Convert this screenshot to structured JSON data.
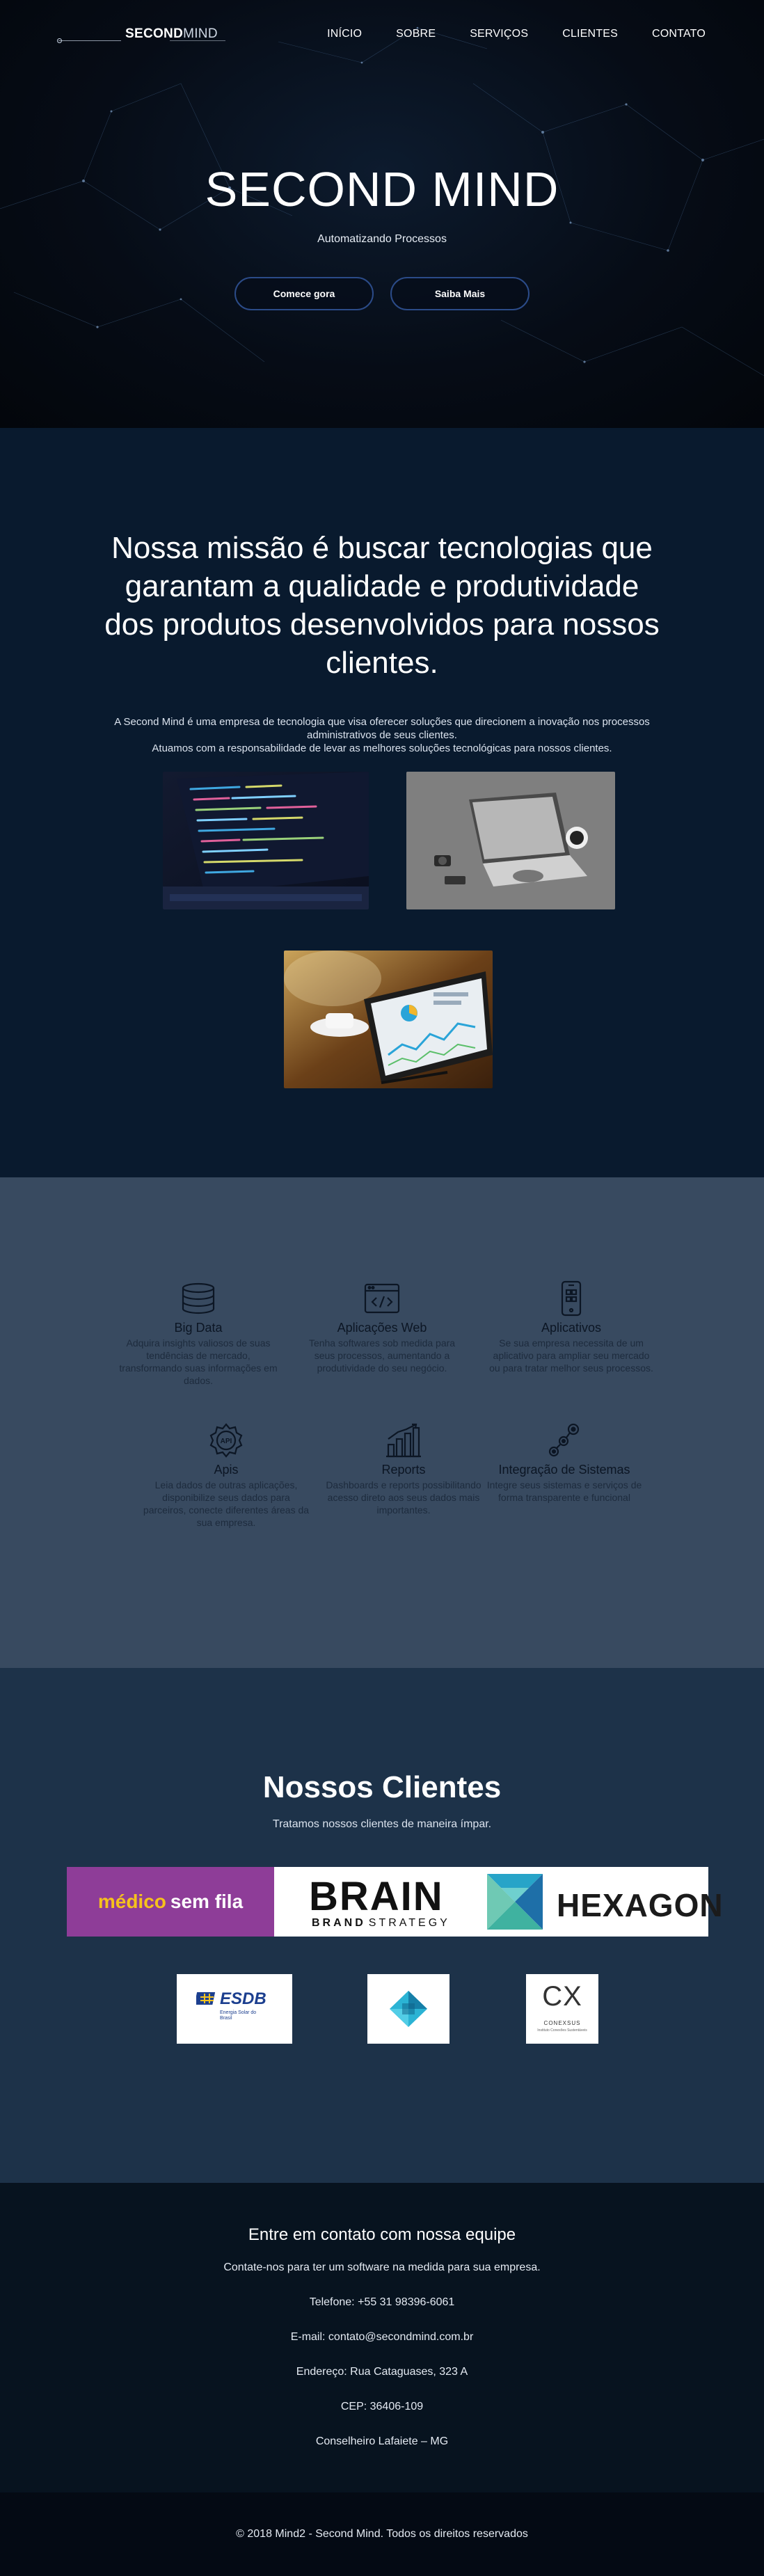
{
  "nav": {
    "logo": {
      "strong": "SECOND",
      "light": "MIND"
    },
    "items": [
      "INÍCIO",
      "SOBRE",
      "SERVIÇOS",
      "CLIENTES",
      "CONTATO"
    ]
  },
  "hero": {
    "title": "SECOND MIND",
    "subtitle": "Automatizando Processos",
    "btn_start": "Comece gora",
    "btn_more": "Saiba Mais"
  },
  "mission": {
    "heading": "Nossa missão é buscar tecnologias que garantam a qualidade e produtividade dos produtos desenvolvidos para nossos clientes.",
    "p1": "A Second Mind é uma empresa de tecnologia que visa oferecer soluções que direcionem a inovação nos processos administrativos de seus clientes.",
    "p2": "Atuamos com a responsabilidade de levar as melhores soluções tecnológicas para nossos clientes."
  },
  "services": [
    {
      "icon": "database-icon",
      "title": "Big Data",
      "text": "Adquira insights valiosos de suas tendências de mercado, transformando suas informações em dados."
    },
    {
      "icon": "code-window-icon",
      "title": "Aplicações Web",
      "text": "Tenha softwares sob medida para seus processos, aumentando a produtividade do seu negócio."
    },
    {
      "icon": "smartphone-icon",
      "title": "Aplicativos",
      "text": "Se sua empresa necessita de um aplicativo para ampliar seu mercado ou para tratar melhor seus processos."
    },
    {
      "icon": "api-gear-icon",
      "title": "Apis",
      "text": "Leia dados de outras aplicações, disponibilize seus dados para parceiros, conecte diferentes áreas da sua empresa."
    },
    {
      "icon": "bar-chart-icon",
      "title": "Reports",
      "text": "Dashboards e reports possibilitando acesso direto aos seus dados mais importantes."
    },
    {
      "icon": "integration-icon",
      "title": "Integração de Sistemas",
      "text": "Integre seus sistemas e serviços de forma transparente e funcional"
    }
  ],
  "clients": {
    "title": "Nossos Clientes",
    "subtitle": "Tratamos nossos clientes de maneira ímpar.",
    "logos": {
      "medico": {
        "a": "médico",
        "b": "sem fila"
      },
      "brain": {
        "main": "BRAIN",
        "sub_a": "BRAND",
        "sub_b": "STRATEGY"
      },
      "hexagon": "HEXAGON",
      "esdb": {
        "main": "ESDB",
        "sub": "Energia Solar do Brasil"
      },
      "conexsus": {
        "mark": "CX",
        "name": "CONEXSUS",
        "sub": "Instituto Conexões Sustentáveis"
      }
    }
  },
  "contact": {
    "title": "Entre em contato com nossa equipe",
    "intro": "Contate-nos para ter um software na medida para sua empresa.",
    "phone": "Telefone: +55 31 98396-6061",
    "email": "E-mail: contato@secondmind.com.br",
    "address": "Endereço: Rua Cataguases, 323 A",
    "cep": "CEP: 36406-109",
    "city": "Conselheiro Lafaiete – MG"
  },
  "footer": {
    "copyright": "© 2018 Mind2 - Second Mind. Todos os direitos reservados"
  },
  "colors": {
    "accent_border": "#2b4b88",
    "mission_bg": "#091a2e",
    "services_bg": "#384a60",
    "clients_bg": "#1d3249",
    "contact_bg": "#07131f",
    "footer_bg": "#040a14"
  }
}
